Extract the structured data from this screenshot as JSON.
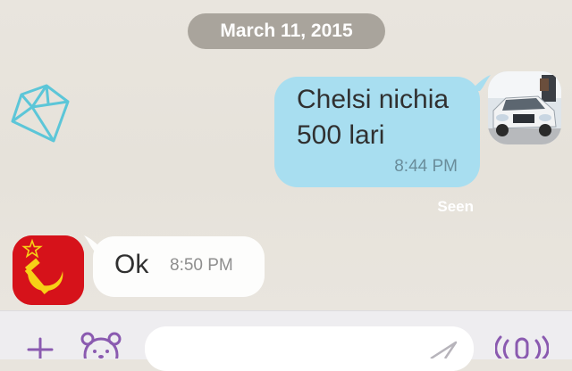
{
  "conversation": {
    "date_label": "March 11, 2015",
    "messages": [
      {
        "direction": "outgoing",
        "lines": [
          "Chelsi nichia",
          "500 lari"
        ],
        "time": "8:44 PM",
        "status": "Seen"
      },
      {
        "direction": "incoming",
        "text": "Ok",
        "time": "8:50 PM"
      }
    ]
  },
  "composer": {
    "input_value": "",
    "input_placeholder": ""
  },
  "icons": {
    "background_decoration": "diamond-outline-icon",
    "outgoing_avatar": "car-photo-avatar",
    "incoming_avatar": "hammer-sickle-avatar",
    "plus": "plus-icon",
    "sticker": "bear-sticker-icon",
    "send": "send-arrow-icon",
    "voice": "voice-wave-icon"
  },
  "colors": {
    "outgoing_bubble": "#a8def0",
    "incoming_bubble": "#fdfdfc",
    "date_pill": "#a9a49c",
    "accent_purple": "#8a5ab0",
    "incoming_avatar_red": "#d6121a"
  }
}
